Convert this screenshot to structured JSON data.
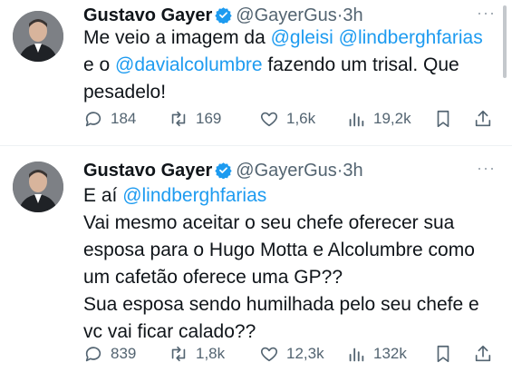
{
  "tweets": [
    {
      "author_name": "Gustavo Gayer",
      "handle": "@GayerGus",
      "separator": "·",
      "time": "3h",
      "lines": [
        [
          {
            "text": "Me veio a imagem da "
          },
          {
            "text": "@gleisi",
            "mention": true
          },
          {
            "text": " "
          },
          {
            "text": "@lindberghfarias",
            "mention": true
          }
        ],
        [
          {
            "text": "e o "
          },
          {
            "text": "@davialcolumbre",
            "mention": true
          },
          {
            "text": " fazendo um trisal. Que"
          }
        ],
        [
          {
            "text": "pesadelo!"
          }
        ]
      ],
      "replies": "184",
      "retweets": "169",
      "likes": "1,6k",
      "views": "19,2k"
    },
    {
      "author_name": "Gustavo Gayer",
      "handle": "@GayerGus",
      "separator": "·",
      "time": "3h",
      "lines": [
        [
          {
            "text": "E aí "
          },
          {
            "text": "@lindberghfarias",
            "mention": true
          }
        ],
        [
          {
            "text": "Vai mesmo aceitar o seu chefe oferecer sua"
          }
        ],
        [
          {
            "text": "esposa para o Hugo Motta e Alcolumbre como"
          }
        ],
        [
          {
            "text": "um cafetão oferece uma GP??"
          }
        ],
        [
          {
            "text": "Sua esposa sendo humilhada pelo seu chefe e"
          }
        ],
        [
          {
            "text": "vc vai ficar calado??"
          }
        ]
      ],
      "replies": "839",
      "retweets": "1,8k",
      "likes": "12,3k",
      "views": "132k"
    }
  ],
  "icons": {
    "verified": "verified-badge-icon",
    "more": "more-options-icon",
    "reply": "reply-icon",
    "retweet": "retweet-icon",
    "like": "heart-icon",
    "views": "views-chart-icon",
    "bookmark": "bookmark-icon",
    "share": "share-icon"
  },
  "colors": {
    "mention": "#1d9bf0",
    "verified": "#1d9bf0",
    "secondary_text": "#536471"
  }
}
